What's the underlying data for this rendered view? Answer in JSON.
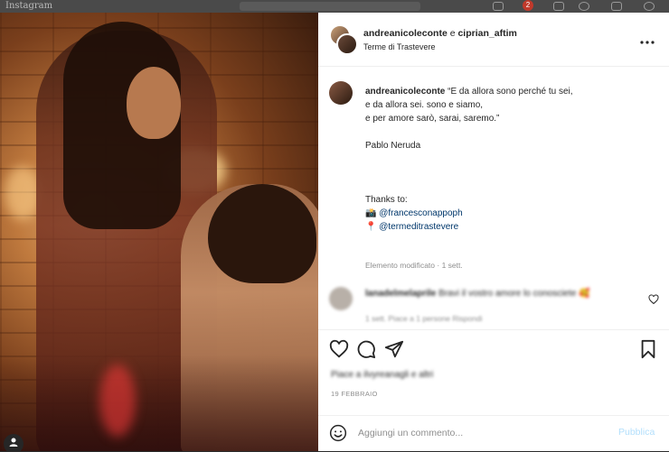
{
  "post": {
    "authors_primary": "andreanicoleconte",
    "authors_conj": "e",
    "authors_secondary": "ciprian_aftim",
    "location": "Terme di Trastevere"
  },
  "caption": {
    "username": "andreanicoleconte",
    "lines": [
      "“E da allora sono perché tu sei,",
      "e da allora sei. sono e siamo,",
      "e per amore sarò, sarai, saremo.”",
      "",
      "Pablo Neruda",
      "",
      "",
      "",
      "Thanks to:"
    ],
    "credits": [
      {
        "emoji": "📸",
        "handle": "@francesconappoph"
      },
      {
        "emoji": "📍",
        "handle": "@termeditrastevere"
      }
    ],
    "meta": "Elemento modificato · 1 sett."
  },
  "comment": {
    "username": "lanadelmelaprile",
    "text": "Bravi il vostro amore lo conosciete 🥰",
    "meta": "1 sett.   Piace a 1 persone   Rispondi"
  },
  "likes_text": "Piace a ilvyreanagli e altri",
  "date": "19 FEBBRAIO",
  "composer": {
    "placeholder": "Aggiungi un commento...",
    "publish_label": "Pubblica"
  },
  "topnav": {
    "logo": "Instagram",
    "notification_count": "2"
  },
  "colors": {
    "link": "#00376b",
    "publish_disabled": "#b2dffc",
    "badge": "#c0392b"
  },
  "icons": [
    "more-icon",
    "heart-icon",
    "comment-icon",
    "share-icon",
    "bookmark-icon",
    "emoji-icon",
    "user-icon"
  ]
}
